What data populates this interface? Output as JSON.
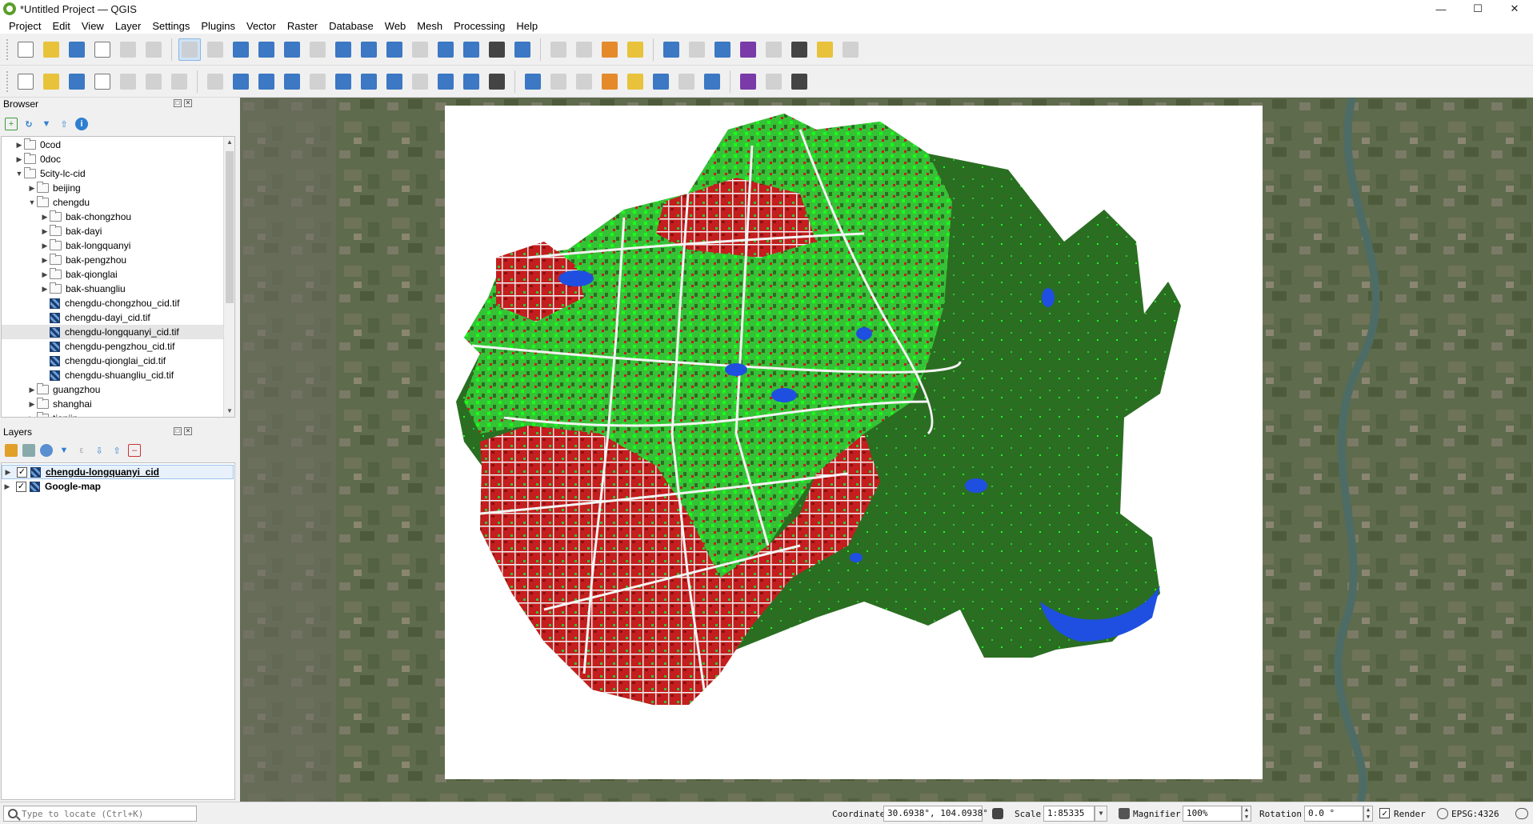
{
  "window": {
    "title": "*Untitled Project — QGIS",
    "minimize": "—",
    "maximize": "☐",
    "close": "✕"
  },
  "menubar": [
    "Project",
    "Edit",
    "View",
    "Layer",
    "Settings",
    "Plugins",
    "Vector",
    "Raster",
    "Database",
    "Web",
    "Mesh",
    "Processing",
    "Help"
  ],
  "toolbar1_icons": [
    "new-project-icon",
    "open-project-icon",
    "save-project-icon",
    "save-as-icon",
    "print-layout-icon",
    "layout-manager-icon",
    "pan-icon",
    "pan-to-selection-icon",
    "zoom-in-icon",
    "zoom-out-icon",
    "zoom-full-icon",
    "zoom-to-selection-icon",
    "zoom-to-layer-icon",
    "zoom-native-icon",
    "zoom-last-icon",
    "zoom-next-icon",
    "new-bookmark-icon",
    "show-bookmarks-icon",
    "temporal-controller-icon",
    "refresh-icon",
    "select-features-icon",
    "select-value-icon",
    "deselect-icon",
    "select-location-icon",
    "identify-icon",
    "attribute-table-icon",
    "processing-toolbox-icon",
    "statistics-icon",
    "field-calc-icon",
    "measure-icon",
    "annotation-icon",
    "map-tips-icon"
  ],
  "toolbar2_icons": [
    "data-source-manager-icon",
    "new-geopackage-icon",
    "new-shapefile-icon",
    "new-spatialite-icon",
    "new-virtual-layer-icon",
    "add-raster-icon",
    "add-vector-icon",
    "digitize-icon",
    "toggle-edit-icon",
    "save-edits-icon",
    "add-feature-icon",
    "vertex-tool-icon",
    "modify-attributes-icon",
    "delete-selected-icon",
    "cut-features-icon",
    "copy-features-icon",
    "paste-features-icon",
    "undo-icon",
    "redo-icon",
    "label-tool-icon",
    "pin-labels-icon",
    "highlight-labels-icon",
    "label-layer-icon",
    "show-labels-icon",
    "move-label-icon",
    "rotate-label-icon",
    "change-label-icon",
    "quick-map-services-icon",
    "python-console-icon",
    "help-icon"
  ],
  "browser": {
    "title": "Browser",
    "rows": [
      {
        "label": "0cod",
        "depth": 0,
        "arrow": "▶",
        "kind": "folder"
      },
      {
        "label": "0doc",
        "depth": 0,
        "arrow": "▶",
        "kind": "folder"
      },
      {
        "label": "5city-lc-cid",
        "depth": 0,
        "arrow": "▼",
        "kind": "folder"
      },
      {
        "label": "beijing",
        "depth": 1,
        "arrow": "▶",
        "kind": "folder"
      },
      {
        "label": "chengdu",
        "depth": 1,
        "arrow": "▼",
        "kind": "folder"
      },
      {
        "label": "bak-chongzhou",
        "depth": 2,
        "arrow": "▶",
        "kind": "folder"
      },
      {
        "label": "bak-dayi",
        "depth": 2,
        "arrow": "▶",
        "kind": "folder"
      },
      {
        "label": "bak-longquanyi",
        "depth": 2,
        "arrow": "▶",
        "kind": "folder"
      },
      {
        "label": "bak-pengzhou",
        "depth": 2,
        "arrow": "▶",
        "kind": "folder"
      },
      {
        "label": "bak-qionglai",
        "depth": 2,
        "arrow": "▶",
        "kind": "folder"
      },
      {
        "label": "bak-shuangliu",
        "depth": 2,
        "arrow": "▶",
        "kind": "folder"
      },
      {
        "label": "chengdu-chongzhou_cid.tif",
        "depth": 2,
        "arrow": "",
        "kind": "raster"
      },
      {
        "label": "chengdu-dayi_cid.tif",
        "depth": 2,
        "arrow": "",
        "kind": "raster"
      },
      {
        "label": "chengdu-longquanyi_cid.tif",
        "depth": 2,
        "arrow": "",
        "kind": "raster",
        "selected": true
      },
      {
        "label": "chengdu-pengzhou_cid.tif",
        "depth": 2,
        "arrow": "",
        "kind": "raster"
      },
      {
        "label": "chengdu-qionglai_cid.tif",
        "depth": 2,
        "arrow": "",
        "kind": "raster"
      },
      {
        "label": "chengdu-shuangliu_cid.tif",
        "depth": 2,
        "arrow": "",
        "kind": "raster"
      },
      {
        "label": "guangzhou",
        "depth": 1,
        "arrow": "▶",
        "kind": "folder"
      },
      {
        "label": "shanghai",
        "depth": 1,
        "arrow": "▶",
        "kind": "folder"
      },
      {
        "label": "tianjin",
        "depth": 1,
        "arrow": "▶",
        "kind": "folder"
      }
    ]
  },
  "layers": {
    "title": "Layers",
    "items": [
      {
        "label": "chengdu-longquanyi_cid",
        "checked": true,
        "selected": true
      },
      {
        "label": "Google-map",
        "checked": true,
        "selected": false
      }
    ]
  },
  "statusbar": {
    "locate_placeholder": "Type to locate (Ctrl+K)",
    "coordinate_label": "Coordinate",
    "coordinate_value": "30.6938°, 104.0938°",
    "scale_label": "Scale",
    "scale_value": "1:85335",
    "magnifier_label": "Magnifier",
    "magnifier_value": "100%",
    "rotation_label": "Rotation",
    "rotation_value": "0.0 °",
    "render_label": "Render",
    "crs_label": "EPSG:4326"
  },
  "colors": {
    "forest": "#2a6e22",
    "grass": "#36c236",
    "bright_green": "#19ff19",
    "urban": "#c41e1e",
    "water": "#1f4fe0",
    "road": "#f2f2f2",
    "basemap": "#5d6a4d"
  }
}
